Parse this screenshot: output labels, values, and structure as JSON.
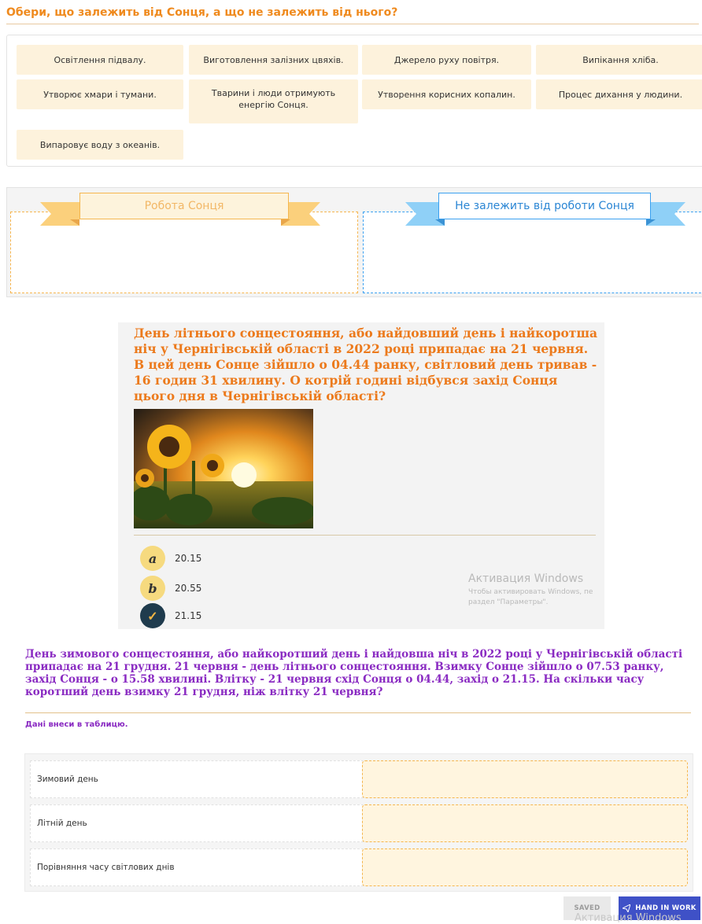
{
  "task1": {
    "title": "Обери, що залежить від Сонця, а що не залежить від нього?",
    "chips": [
      "Освітлення підвалу.",
      "Виготовлення залізних цвяхів.",
      "Джерело руху повітря.",
      "Випікання хліба.",
      "Утворює хмари і тумани.",
      "Тварини і люди отримують енергію Сонця.",
      "Утворення корисних копалин.",
      "Процес дихання у людини.",
      "Випаровує воду з океанів."
    ],
    "categories": {
      "sun": "Робота Сонця",
      "not_sun": "Не залежить від роботи Сонця"
    },
    "colors": {
      "accent": "#ef8a1e",
      "chip_bg": "#fdf2dc",
      "sun_border": "#f6b54e",
      "blue_border": "#3aa0f0"
    }
  },
  "task2": {
    "question": "День літнього сонцестояння, або найдовший день і найкоротша ніч у Чернігівській області в 2022 році припадає на 21 червня. В цей день Сонце зійшло о 04.44 ранку, світловий день тривав - 16 годин 31 хвилину. О котрій годині відбувся захід Сонця цього дня в Чернігівській області?",
    "image": "sunflowers-sunset",
    "options": [
      {
        "letter": "a",
        "text": "20.15",
        "selected": false
      },
      {
        "letter": "b",
        "text": "20.55",
        "selected": false
      },
      {
        "letter": "✓",
        "text": "21.15",
        "selected": true
      }
    ],
    "watermark": {
      "line1": "Активация Windows",
      "line2": "Чтобы активировать Windows, пе",
      "line3": "раздел \"Параметры\"."
    }
  },
  "task3": {
    "question": "День зимового сонцестояння, або найкоротший день і найдовша ніч в 2022 році у Чернігівській області припадає на 21 грудня. 21 червня - день літнього сонцестояння. Взимку Сонце зійшло о 07.53 ранку, захід Сонця - о 15.58 хвилині. Влітку - 21 червня схід Сонця о 04.44, захід о 21.15. На скільки часу коротший день взимку 21 грудня, ніж влітку 21 червня?",
    "instruction": "Дані внеси в таблицю.",
    "rows": [
      "Зимовий день",
      "Літній день",
      "Порівняння часу світлових днів"
    ]
  },
  "footer": {
    "saved_label": "SAVED",
    "hand_in_label": "HAND IN WORK",
    "watermark": "Активация Windows"
  }
}
